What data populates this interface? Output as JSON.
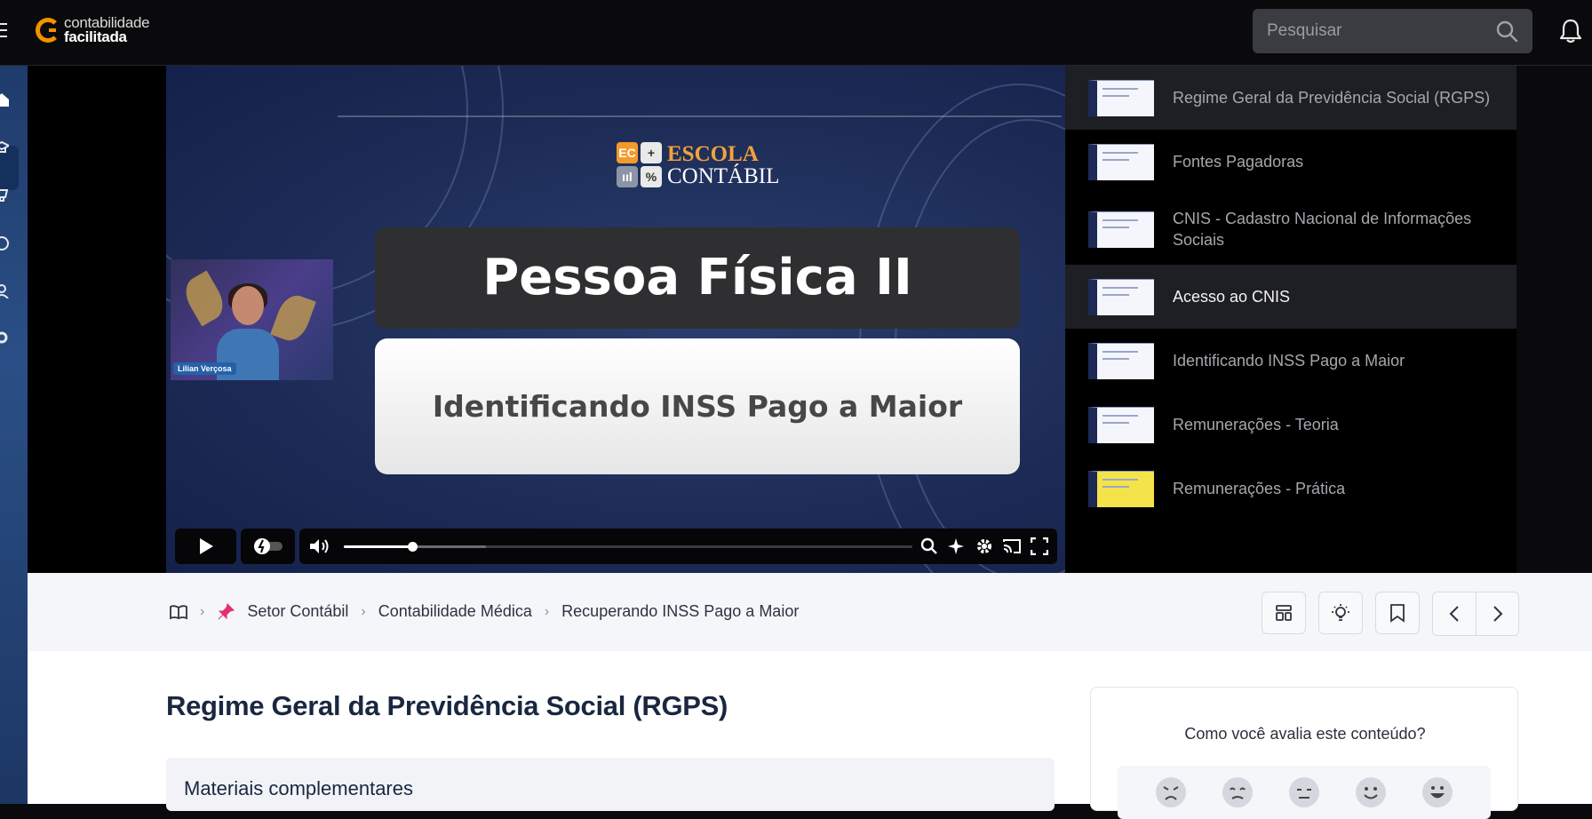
{
  "header": {
    "logo_line1": "contabilidade",
    "logo_line2": "facilitada",
    "search_placeholder": "Pesquisar"
  },
  "video": {
    "brand_line1": "ESCOLA",
    "brand_line2": "CONTÁBIL",
    "brand_cells": [
      "EC",
      "+",
      "ııl",
      "%"
    ],
    "slide_title": "Pessoa Física II",
    "slide_subtitle": "Identificando INSS Pago a Maior",
    "presenter_name": "Lilian Verçosa",
    "progress": 0.12,
    "buffered": 0.25
  },
  "playlist": {
    "items": [
      {
        "title": "Regime Geral da Previdência Social (RGPS)",
        "state": "active"
      },
      {
        "title": "Fontes Pagadoras",
        "state": ""
      },
      {
        "title": "CNIS - Cadastro Nacional de Informações Sociais",
        "state": ""
      },
      {
        "title": "Acesso ao CNIS",
        "state": "current"
      },
      {
        "title": "Identificando INSS Pago a Maior",
        "state": ""
      },
      {
        "title": "Remunerações - Teoria",
        "state": ""
      },
      {
        "title": "Remunerações - Prática",
        "state": ""
      }
    ]
  },
  "breadcrumb": {
    "items": [
      "Setor Contábil",
      "Contabilidade Médica",
      "Recuperando INSS Pago a Maior"
    ]
  },
  "content": {
    "title": "Regime Geral da Previdência Social (RGPS)",
    "materials_label": "Materiais complementares",
    "rating_question": "Como você avalia este conteúdo?"
  },
  "colors": {
    "accent_orange": "#f39200",
    "dark_bg": "#0a0a0c",
    "navy": "#1c2b55"
  }
}
